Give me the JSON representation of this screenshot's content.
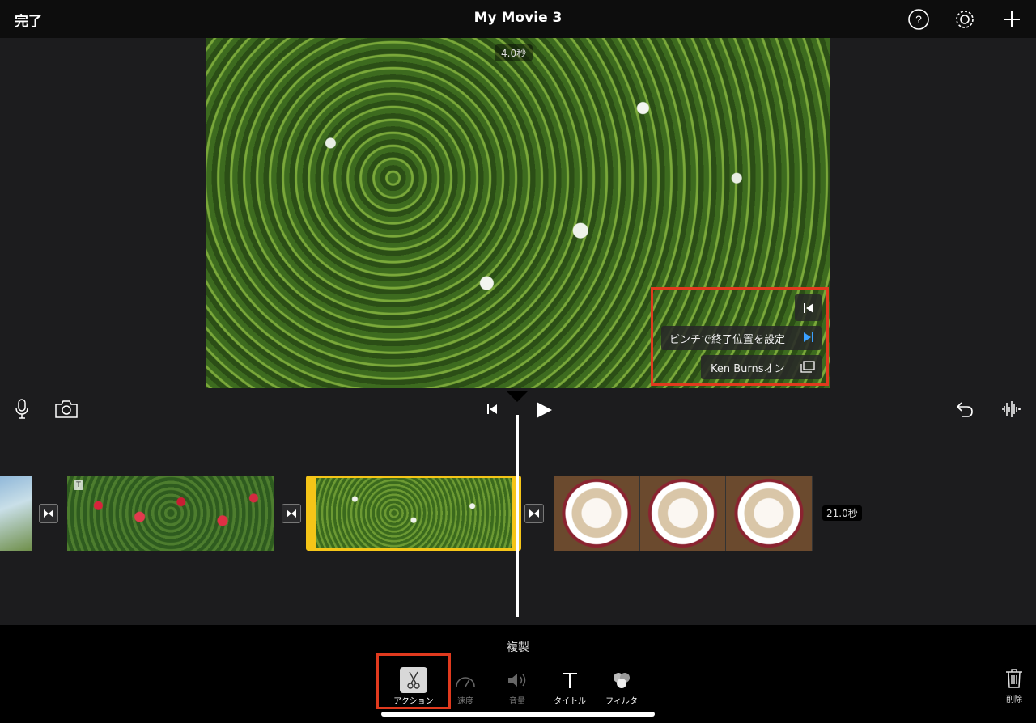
{
  "topbar": {
    "done_label": "完了",
    "project_title": "My Movie 3",
    "icons": [
      "help-icon",
      "settings-icon",
      "add-icon"
    ]
  },
  "viewer": {
    "clip_duration": "4.0秒",
    "ken_burns": {
      "end_position_label": "ピンチで終了位置を設定",
      "toggle_label": "Ken Burnsオン",
      "highlight_color": "#e03a1e"
    }
  },
  "controls": {
    "icons": [
      "microphone-icon",
      "camera-icon",
      "skip-to-start-icon",
      "play-icon",
      "undo-icon",
      "audio-waveform-icon"
    ]
  },
  "timeline": {
    "total_duration": "21.0秒",
    "selected_clip_color": "#f5c518"
  },
  "toolbar": {
    "selected_tool_label": "複製",
    "tools": [
      {
        "label": "アクション",
        "icon": "scissors-icon",
        "selected": true
      },
      {
        "label": "速度",
        "icon": "speedometer-icon",
        "selected": false
      },
      {
        "label": "音量",
        "icon": "speaker-icon",
        "selected": false
      },
      {
        "label": "タイトル",
        "icon": "title-t-icon",
        "selected": false
      },
      {
        "label": "フィルタ",
        "icon": "filters-icon",
        "selected": false
      }
    ],
    "delete_label": "削除"
  }
}
